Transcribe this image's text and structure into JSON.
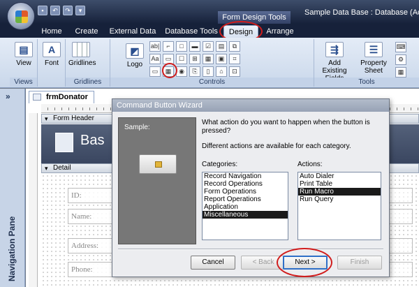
{
  "window": {
    "title": "Sample Data Base : Database (Access",
    "context_tab": "Form Design Tools"
  },
  "tabs": [
    {
      "label": "Home"
    },
    {
      "label": "Create"
    },
    {
      "label": "External Data"
    },
    {
      "label": "Database Tools"
    },
    {
      "label": "Design",
      "active": true
    },
    {
      "label": "Arrange"
    }
  ],
  "ribbon": {
    "groups": {
      "views": "Views",
      "gridlines": "Gridlines",
      "controls": "Controls",
      "tools": "Tools"
    },
    "buttons": {
      "view": "View",
      "font": "Font",
      "gridlines": "Gridlines",
      "logo": "Logo",
      "add_existing_fields": "Add Existing Fields",
      "property_sheet": "Property Sheet"
    },
    "control_glyphs": [
      "ab|",
      "⌐",
      "□",
      "▬",
      "☑",
      "▤",
      "⧉",
      "Aa",
      "▭",
      "☐",
      "⊞",
      "▦",
      "▣",
      "⌗",
      "▭",
      "▦",
      "◉",
      "⎘",
      "▯",
      "⌂",
      "⊡"
    ]
  },
  "nav_pane": {
    "collapse": "»",
    "label": "Navigation Pane"
  },
  "document": {
    "tab_name": "frmDonator",
    "form_header": "Form Header",
    "header_title": "Bas",
    "detail": "Detail",
    "field_labels": [
      "ID:",
      "Name:",
      "Address:",
      "Phone:"
    ]
  },
  "dialog": {
    "title": "Command Button Wizard",
    "sample_label": "Sample:",
    "question": "What action do you want to happen when the button is pressed?",
    "hint": "Different actions are available for each category.",
    "categories_label": "Categories:",
    "actions_label": "Actions:",
    "categories": [
      "Record Navigation",
      "Record Operations",
      "Form Operations",
      "Report Operations",
      "Application",
      "Miscellaneous"
    ],
    "categories_selected": "Miscellaneous",
    "actions": [
      "Auto Dialer",
      "Print Table",
      "Run Macro",
      "Run Query"
    ],
    "actions_selected": "Run Macro",
    "buttons": {
      "cancel": "Cancel",
      "back": "< Back",
      "next": "Next >",
      "finish": "Finish"
    }
  },
  "colors": {
    "annotation": "#d01c1c",
    "titlebar": "#16213a",
    "ribbon": "#dbe5f3"
  }
}
